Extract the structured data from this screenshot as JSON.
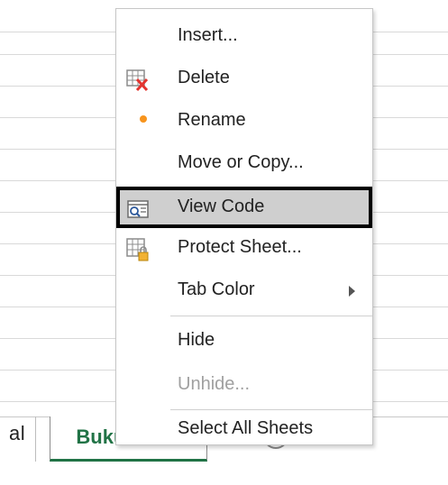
{
  "sheet_tabs": {
    "left_tab_fragment": "al",
    "active_tab": "BukuBesar",
    "add_sheet_symbol": "+"
  },
  "context_menu": {
    "items": [
      {
        "label": "Insert...",
        "icon": "",
        "enabled": true
      },
      {
        "label": "Delete",
        "icon": "delete-sheet-icon",
        "enabled": true
      },
      {
        "label": "Rename",
        "icon": "rename-dot-icon",
        "enabled": true
      },
      {
        "label": "Move or Copy...",
        "icon": "",
        "enabled": true
      },
      {
        "label": "View Code",
        "icon": "view-code-icon",
        "enabled": true,
        "highlighted": true
      },
      {
        "label": "Protect Sheet...",
        "icon": "protect-sheet-icon",
        "enabled": true
      },
      {
        "label": "Tab Color",
        "icon": "",
        "enabled": true,
        "has_submenu": true
      },
      {
        "label": "Hide",
        "icon": "",
        "enabled": true
      },
      {
        "label": "Unhide...",
        "icon": "",
        "enabled": false
      },
      {
        "label": "Select All Sheets",
        "icon": "",
        "enabled": true
      }
    ]
  },
  "colors": {
    "excel_green": "#217346",
    "highlight_gray": "#cfcfcf",
    "rename_dot": "#f7941d",
    "delete_x": "#e3342f"
  }
}
